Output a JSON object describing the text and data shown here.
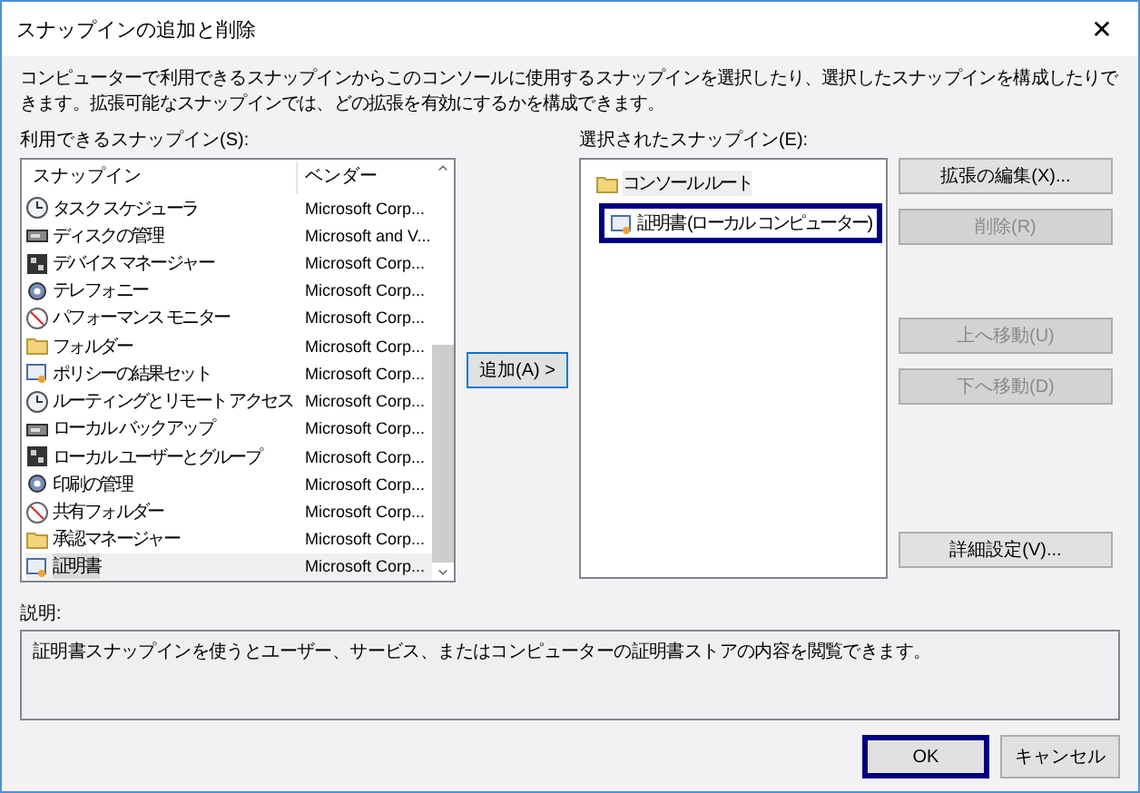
{
  "window": {
    "title": "スナップインの追加と削除",
    "close": "✕"
  },
  "intro": "コンピューターで利用できるスナップインからこのコンソールに使用するスナップインを選択したり、選択したスナップインを構成したりできます。拡張可能なスナップインでは、どの拡張を有効にするかを構成できます。",
  "available": {
    "label": "利用できるスナップイン(S):",
    "columns": [
      "スナップイン",
      "ベンダー"
    ],
    "rows": [
      {
        "name": "タスク スケジューラ",
        "vendor": "Microsoft Corp...",
        "selected": false
      },
      {
        "name": "ディスクの管理",
        "vendor": "Microsoft and V...",
        "selected": false
      },
      {
        "name": "デバイス マネージャー",
        "vendor": "Microsoft Corp...",
        "selected": false
      },
      {
        "name": "テレフォニー",
        "vendor": "Microsoft Corp...",
        "selected": false
      },
      {
        "name": "パフォーマンス モニター",
        "vendor": "Microsoft Corp...",
        "selected": false
      },
      {
        "name": "フォルダー",
        "vendor": "Microsoft Corp...",
        "selected": false
      },
      {
        "name": "ポリシーの結果セット",
        "vendor": "Microsoft Corp...",
        "selected": false
      },
      {
        "name": "ルーティングとリモート アクセス",
        "vendor": "Microsoft Corp...",
        "selected": false
      },
      {
        "name": "ローカル バックアップ",
        "vendor": "Microsoft Corp...",
        "selected": false
      },
      {
        "name": "ローカル ユーザーとグループ",
        "vendor": "Microsoft Corp...",
        "selected": false
      },
      {
        "name": "印刷の管理",
        "vendor": "Microsoft Corp...",
        "selected": false
      },
      {
        "name": "共有フォルダー",
        "vendor": "Microsoft Corp...",
        "selected": false
      },
      {
        "name": "承認マネージャー",
        "vendor": "Microsoft Corp...",
        "selected": false
      },
      {
        "name": "証明書",
        "vendor": "Microsoft Corp...",
        "selected": true
      }
    ]
  },
  "add_button": {
    "label": "追加(A) >"
  },
  "selected_snapins": {
    "label": "選択されたスナップイン(E):",
    "tree": [
      {
        "label": "コンソール ルート",
        "selected": false,
        "children": [
          {
            "label": "証明書 (ローカル コンピューター)",
            "selected": true
          }
        ]
      }
    ]
  },
  "side_buttons": [
    {
      "label": "拡張の編集(X)...",
      "disabled": false
    },
    {
      "label": "削除(R)",
      "disabled": true
    },
    {
      "label": "上へ移動(U)",
      "disabled": true
    },
    {
      "label": "下へ移動(D)",
      "disabled": true
    },
    {
      "label": "詳細設定(V)...",
      "disabled": false
    }
  ],
  "description": {
    "label": "説明:",
    "text": "証明書スナップインを使うとユーザー、サービス、またはコンピューターの証明書ストアの内容を閲覧できます。"
  },
  "footer_buttons": [
    {
      "label": "OK",
      "default": true
    },
    {
      "label": "キャンセル",
      "default": false
    }
  ]
}
